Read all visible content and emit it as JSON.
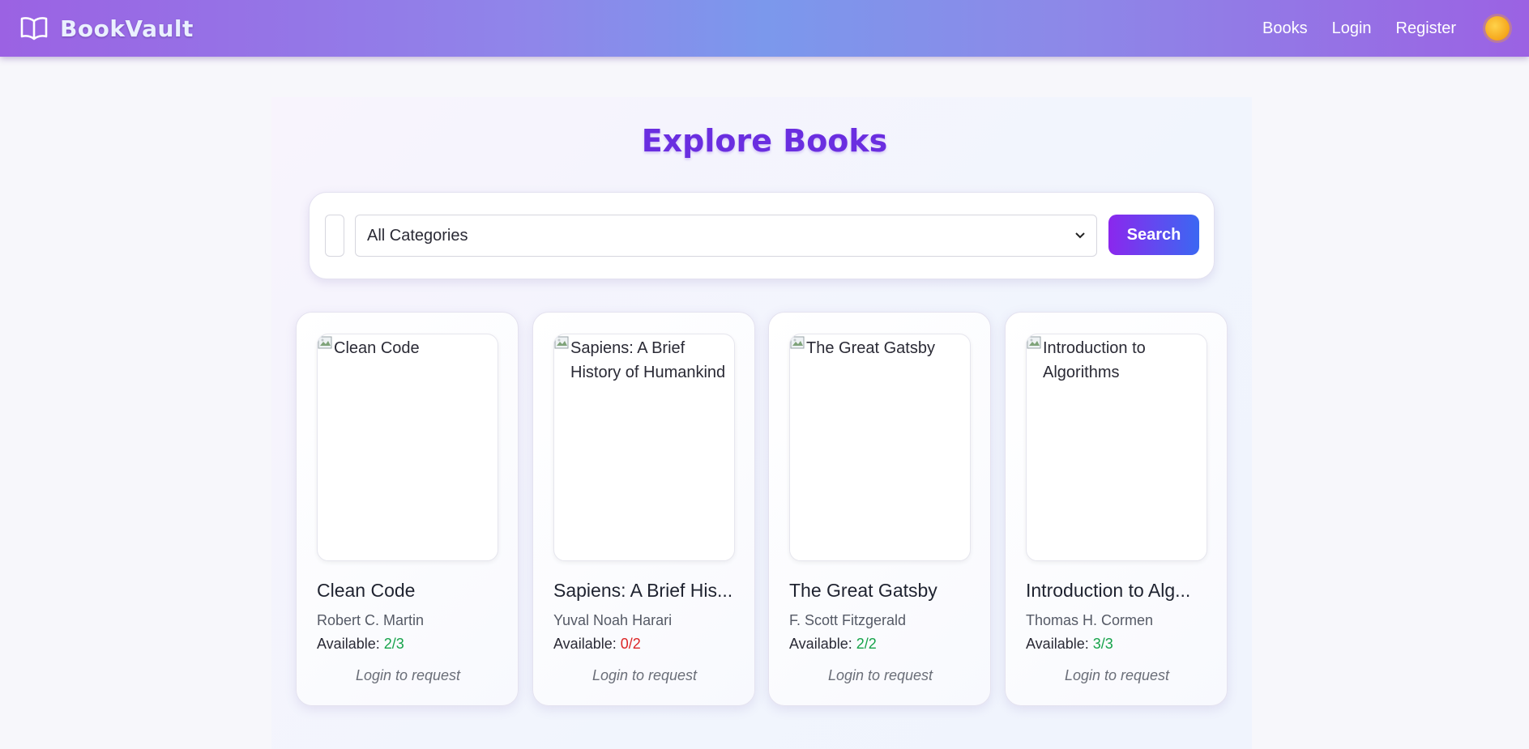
{
  "nav": {
    "brand": "BookVault",
    "links": [
      "Books",
      "Login",
      "Register"
    ]
  },
  "page": {
    "title": "Explore Books"
  },
  "search": {
    "category_selected": "All Categories",
    "button_label": "Search"
  },
  "books": [
    {
      "cover_alt": "Clean Code",
      "title": "Clean Code",
      "author": "Robert C. Martin",
      "available_label": "Available:",
      "available": "2/3",
      "available_color": "#16a34a",
      "action": "Login to request"
    },
    {
      "cover_alt": "Sapiens: A Brief History of Humankind",
      "title": "Sapiens: A Brief His...",
      "author": "Yuval Noah Harari",
      "available_label": "Available:",
      "available": "0/2",
      "available_color": "#dc2626",
      "action": "Login to request"
    },
    {
      "cover_alt": "The Great Gatsby",
      "title": "The Great Gatsby",
      "author": "F. Scott Fitzgerald",
      "available_label": "Available:",
      "available": "2/2",
      "available_color": "#16a34a",
      "action": "Login to request"
    },
    {
      "cover_alt": "Introduction to Algorithms",
      "title": "Introduction to Alg...",
      "author": "Thomas H. Cormen",
      "available_label": "Available:",
      "available": "3/3",
      "available_color": "#16a34a",
      "action": "Login to request"
    }
  ],
  "icons": {
    "brand": "open-book-icon",
    "theme": "sun-icon",
    "select": "chevron-down-icon",
    "broken_image": "broken-image-icon"
  },
  "colors": {
    "accent": "#6a2ee0",
    "available_ok": "#16a34a",
    "available_none": "#dc2626"
  }
}
